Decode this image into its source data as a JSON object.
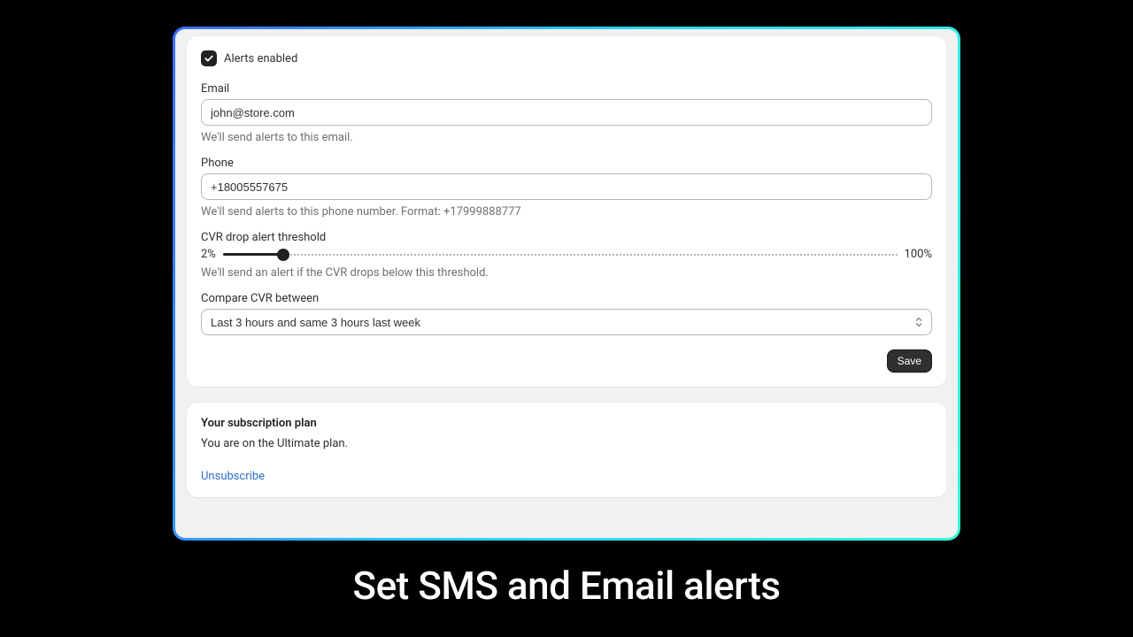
{
  "alerts": {
    "enabled_label": "Alerts enabled",
    "email": {
      "label": "Email",
      "value": "john@store.com",
      "help": "We'll send alerts to this email."
    },
    "phone": {
      "label": "Phone",
      "value": "+18005557675",
      "help": "We'll send alerts to this phone number. Format: +17999888777"
    },
    "threshold": {
      "label": "CVR drop alert threshold",
      "min_label": "2%",
      "max_label": "100%",
      "percent": 9,
      "help": "We'll send an alert if the CVR drops below this threshold."
    },
    "compare": {
      "label": "Compare CVR between",
      "selected": "Last 3 hours and same 3 hours last week"
    },
    "save_label": "Save"
  },
  "subscription": {
    "title": "Your subscription plan",
    "text": "You are on the Ultimate plan.",
    "unsubscribe_label": "Unsubscribe"
  },
  "caption": "Set SMS and Email alerts"
}
